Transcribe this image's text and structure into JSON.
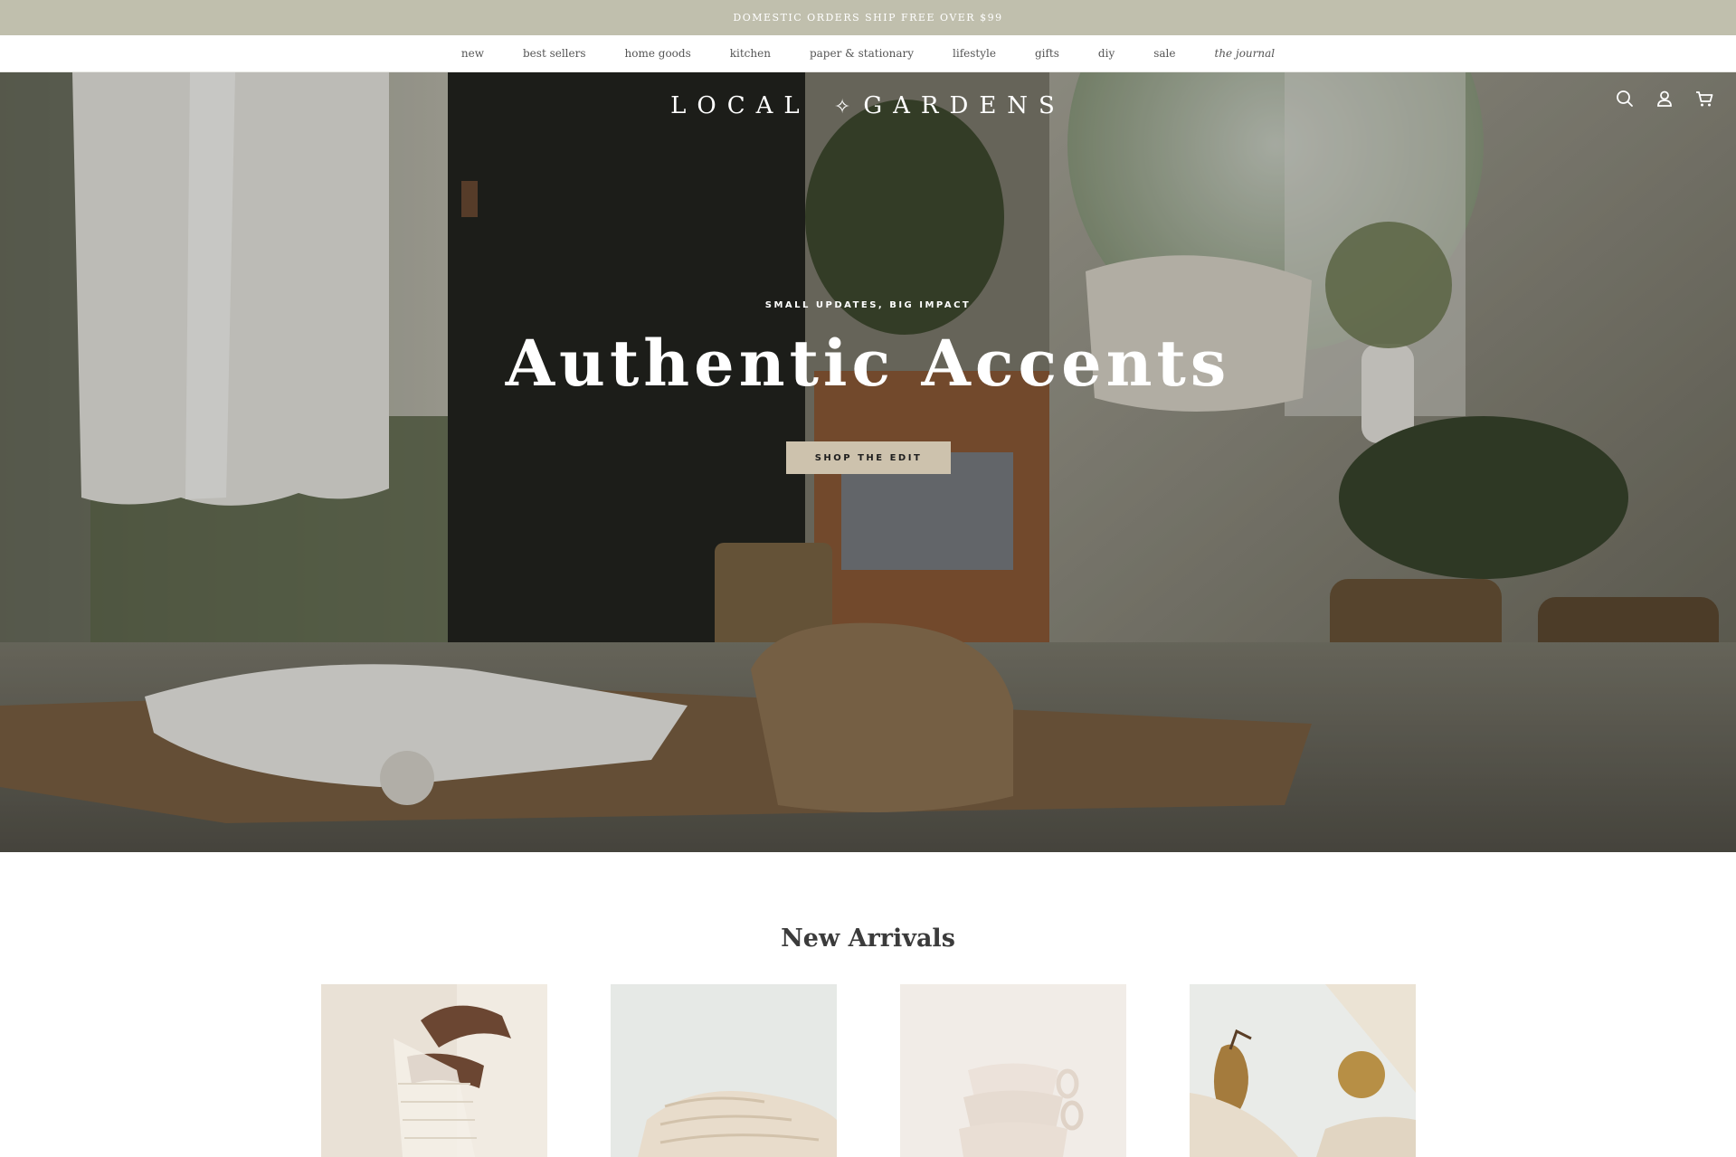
{
  "announcement": {
    "text": "DOMESTIC ORDERS SHIP FREE OVER $99"
  },
  "nav": {
    "items": [
      {
        "label": "new"
      },
      {
        "label": "best sellers"
      },
      {
        "label": "home goods"
      },
      {
        "label": "kitchen"
      },
      {
        "label": "paper & stationary"
      },
      {
        "label": "lifestyle"
      },
      {
        "label": "gifts"
      },
      {
        "label": "diy"
      },
      {
        "label": "sale"
      },
      {
        "label": "the journal"
      }
    ]
  },
  "header": {
    "logo_left": "LOCAL",
    "logo_right": "GARDENS",
    "logo_icon": "sparkle-star-icon",
    "icons": [
      "search-icon",
      "account-icon",
      "cart-icon"
    ]
  },
  "hero": {
    "eyebrow": "SMALL UPDATES, BIG IMPACT",
    "title": "Authentic Accents",
    "cta_label": "SHOP THE EDIT"
  },
  "new_arrivals": {
    "title": "New Arrivals",
    "products": [
      {
        "image": "hands holding mesh bag"
      },
      {
        "image": "folded knit towels"
      },
      {
        "image": "stacked ceramic cups"
      },
      {
        "image": "pears with knit bags"
      }
    ]
  }
}
